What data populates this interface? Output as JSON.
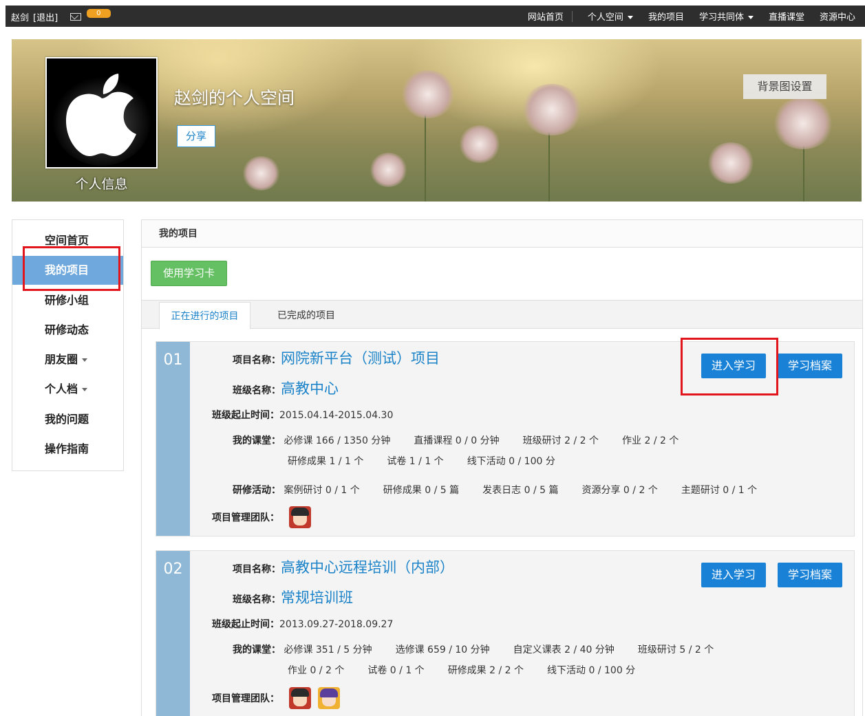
{
  "topbar": {
    "user_name": "赵剑",
    "logout": "[退出]",
    "mail_icon": "mail-icon",
    "mail_count": "0",
    "nav": [
      {
        "label": "网站首页",
        "dropdown": false
      },
      {
        "label": "个人空间",
        "dropdown": true
      },
      {
        "label": "我的项目",
        "dropdown": false
      },
      {
        "label": "学习共同体",
        "dropdown": true
      },
      {
        "label": "直播课堂",
        "dropdown": false
      },
      {
        "label": "资源中心",
        "dropdown": false
      }
    ]
  },
  "banner": {
    "space_title": "赵剑的个人空间",
    "share": "分享",
    "bg_setting": "背景图设置",
    "profile_label": "个人信息",
    "avatar_icon": "apple-logo-icon"
  },
  "sidebar": {
    "items": [
      {
        "label": "空间首页",
        "dropdown": false
      },
      {
        "label": "我的项目",
        "dropdown": false,
        "active": true
      },
      {
        "label": "研修小组",
        "dropdown": false
      },
      {
        "label": "研修动态",
        "dropdown": false
      },
      {
        "label": "朋友圈",
        "dropdown": true
      },
      {
        "label": "个人档",
        "dropdown": true
      },
      {
        "label": "我的问题",
        "dropdown": false
      },
      {
        "label": "操作指南",
        "dropdown": false
      }
    ]
  },
  "main": {
    "header": "我的项目",
    "use_card": "使用学习卡",
    "tabs": [
      "正在进行的项目",
      "已完成的项目"
    ]
  },
  "labels": {
    "project_name": "项目名称：",
    "class_name": "班级名称：",
    "period": "班级起止时间：",
    "my_class": "我的课堂：",
    "activities": "研修活动：",
    "team": "项目管理团队："
  },
  "projects": [
    {
      "num": "01",
      "name": "网院新平台（测试）项目",
      "class": "高教中心",
      "period": "2015.04.14-2015.04.30",
      "class_stats_line1": [
        "必修课 166 / 1350 分钟",
        "直播课程 0 / 0 分钟",
        "班级研讨 2 / 2 个",
        "作业 2 / 2 个"
      ],
      "class_stats_line2": [
        "研修成果 1 / 1 个",
        "试卷 1 / 1 个",
        "线下活动 0 / 100 分"
      ],
      "activities": [
        "案例研讨 0 / 1 个",
        "研修成果 0 / 5 篇",
        "发表日志 0 / 5 篇",
        "资源分享 0 / 2 个",
        "主题研讨 0 / 1 个"
      ],
      "enter": "进入学习",
      "archive": "学习档案"
    },
    {
      "num": "02",
      "name": "高教中心远程培训（内部）",
      "class": "常规培训班",
      "period": "2013.09.27-2018.09.27",
      "class_stats_line1": [
        "必修课 351 / 5 分钟",
        "选修课 659 / 10 分钟",
        "自定义课表 2 / 40 分钟",
        "班级研讨 5 / 2 个"
      ],
      "class_stats_line2": [
        "作业 0 / 2 个",
        "试卷 0 / 1 个",
        "研修成果 2 / 2 个",
        "线下活动 0 / 100 分"
      ],
      "enter": "进入学习",
      "archive": "学习档案"
    }
  ],
  "colors": {
    "accent_blue": "#1a82d6",
    "active_sidebar": "#6fa8dc",
    "highlight_red": "#e2141c",
    "green_button": "#64c062"
  }
}
